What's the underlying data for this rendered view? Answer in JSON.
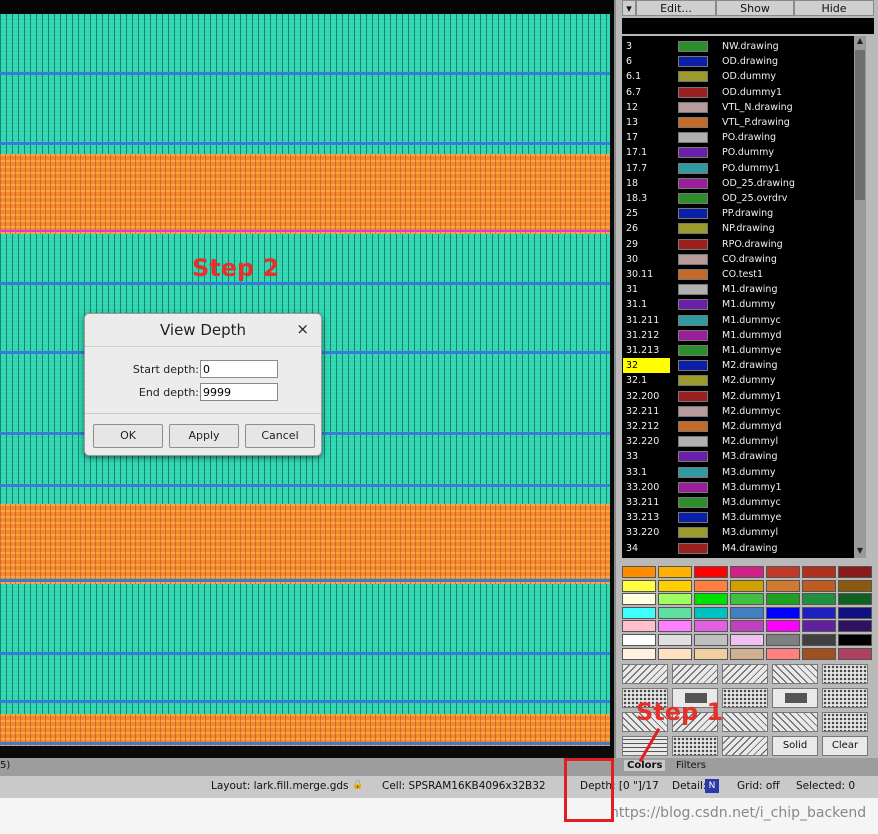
{
  "dialog": {
    "title": "View Depth",
    "close": "×",
    "start_label": "Start depth:",
    "start_value": "0",
    "end_label": "End depth:",
    "end_value": "9999",
    "ok": "OK",
    "apply": "Apply",
    "cancel": "Cancel"
  },
  "annotations": {
    "step2": "Step 2",
    "step1": "Step 1"
  },
  "toolbar": {
    "edit": "Edit...",
    "show": "Show",
    "hide": "Hide"
  },
  "layers": [
    {
      "num": "3",
      "name": "NW.drawing",
      "color": "#2c8f2c"
    },
    {
      "num": "6",
      "name": "OD.drawing",
      "color": "#0b1fa8"
    },
    {
      "num": "6.1",
      "name": "OD.dummy",
      "color": "#9c9a2a"
    },
    {
      "num": "6.7",
      "name": "OD.dummy1",
      "color": "#9a1f1f"
    },
    {
      "num": "12",
      "name": "VTL_N.drawing",
      "color": "#b79a9a"
    },
    {
      "num": "13",
      "name": "VTL_P.drawing",
      "color": "#c66a2a"
    },
    {
      "num": "17",
      "name": "PO.drawing",
      "color": "#b0b0b0"
    },
    {
      "num": "17.1",
      "name": "PO.dummy",
      "color": "#6a1fa8"
    },
    {
      "num": "17.7",
      "name": "PO.dummy1",
      "color": "#2f9aa0"
    },
    {
      "num": "18",
      "name": "OD_25.drawing",
      "color": "#9a1f9a"
    },
    {
      "num": "18.3",
      "name": "OD_25.ovrdrv",
      "color": "#2c8f2c"
    },
    {
      "num": "25",
      "name": "PP.drawing",
      "color": "#0b1fa8"
    },
    {
      "num": "26",
      "name": "NP.drawing",
      "color": "#9c9a2a"
    },
    {
      "num": "29",
      "name": "RPO.drawing",
      "color": "#9a1f1f"
    },
    {
      "num": "30",
      "name": "CO.drawing",
      "color": "#b79a9a"
    },
    {
      "num": "30.11",
      "name": "CO.test1",
      "color": "#c66a2a"
    },
    {
      "num": "31",
      "name": "M1.drawing",
      "color": "#b0b0b0"
    },
    {
      "num": "31.1",
      "name": "M1.dummy",
      "color": "#6a1fa8"
    },
    {
      "num": "31.211",
      "name": "M1.dummyc",
      "color": "#2f9aa0"
    },
    {
      "num": "31.212",
      "name": "M1.dummyd",
      "color": "#9a1f9a"
    },
    {
      "num": "31.213",
      "name": "M1.dummye",
      "color": "#2c8f2c"
    },
    {
      "num": "32",
      "name": "M2.drawing",
      "color": "#0b1fa8",
      "selected": true
    },
    {
      "num": "32.1",
      "name": "M2.dummy",
      "color": "#9c9a2a"
    },
    {
      "num": "32.200",
      "name": "M2.dummy1",
      "color": "#9a1f1f"
    },
    {
      "num": "32.211",
      "name": "M2.dummyc",
      "color": "#b79a9a"
    },
    {
      "num": "32.212",
      "name": "M2.dummyd",
      "color": "#c66a2a"
    },
    {
      "num": "32.220",
      "name": "M2.dummyl",
      "color": "#b0b0b0"
    },
    {
      "num": "33",
      "name": "M3.drawing",
      "color": "#6a1fa8"
    },
    {
      "num": "33.1",
      "name": "M3.dummy",
      "color": "#2f9aa0"
    },
    {
      "num": "33.200",
      "name": "M3.dummy1",
      "color": "#9a1f9a"
    },
    {
      "num": "33.211",
      "name": "M3.dummyc",
      "color": "#2c8f2c"
    },
    {
      "num": "33.213",
      "name": "M3.dummye",
      "color": "#0b1fa8"
    },
    {
      "num": "33.220",
      "name": "M3.dummyl",
      "color": "#9c9a2a"
    },
    {
      "num": "34",
      "name": "M4.drawing",
      "color": "#9a1f1f"
    }
  ],
  "palette_colors": [
    [
      "#ff8c00",
      "#ffb000",
      "#ff0000",
      "#d0208a",
      "#c03a2a",
      "#b03020",
      "#8a1a1a"
    ],
    [
      "#ffff40",
      "#ffd000",
      "#ff8040",
      "#d0a000",
      "#d07a30",
      "#c05a20",
      "#8a5a10"
    ],
    [
      "#ffffe0",
      "#a0ff60",
      "#00e000",
      "#40c040",
      "#20a020",
      "#209040",
      "#106020"
    ],
    [
      "#40ffff",
      "#60e0a0",
      "#00c0c0",
      "#4080c0",
      "#0000ff",
      "#2020c0",
      "#101080"
    ],
    [
      "#ffc0cb",
      "#ff80ff",
      "#e060e0",
      "#c040c0",
      "#ff00ff",
      "#6020a0",
      "#301060"
    ],
    [
      "#ffffff",
      "#e0e0e0",
      "#c0c0c0",
      "#f0c0f0",
      "#808080",
      "#404040",
      "#000000"
    ],
    [
      "#fff0e0",
      "#ffe0c0",
      "#f0d0a0",
      "#d0b090",
      "#ff8080",
      "#a05020",
      "#b04060"
    ]
  ],
  "stipple_buttons": {
    "solid": "Solid",
    "clear": "Clear"
  },
  "tabs": {
    "colors": "Colors",
    "filters": "Filters",
    "left_fragment": "5)"
  },
  "status": {
    "layout": "Layout:  lark.fill.merge.gds",
    "cell": "Cell:  SPSRAM16KB4096x32B32",
    "depth": "Depth: [0 \"]/17",
    "detail": "Detail:",
    "detail_icon": "N",
    "grid": "Grid:  off",
    "selected": "Selected:  0"
  },
  "watermark": "https://blog.csdn.net/i_chip_backend",
  "colors": {
    "annotation_red": "#e02020",
    "layout_green": "#2fd6b0",
    "layout_orange": "#f08a2c",
    "selected_yellow": "#ffff00"
  }
}
